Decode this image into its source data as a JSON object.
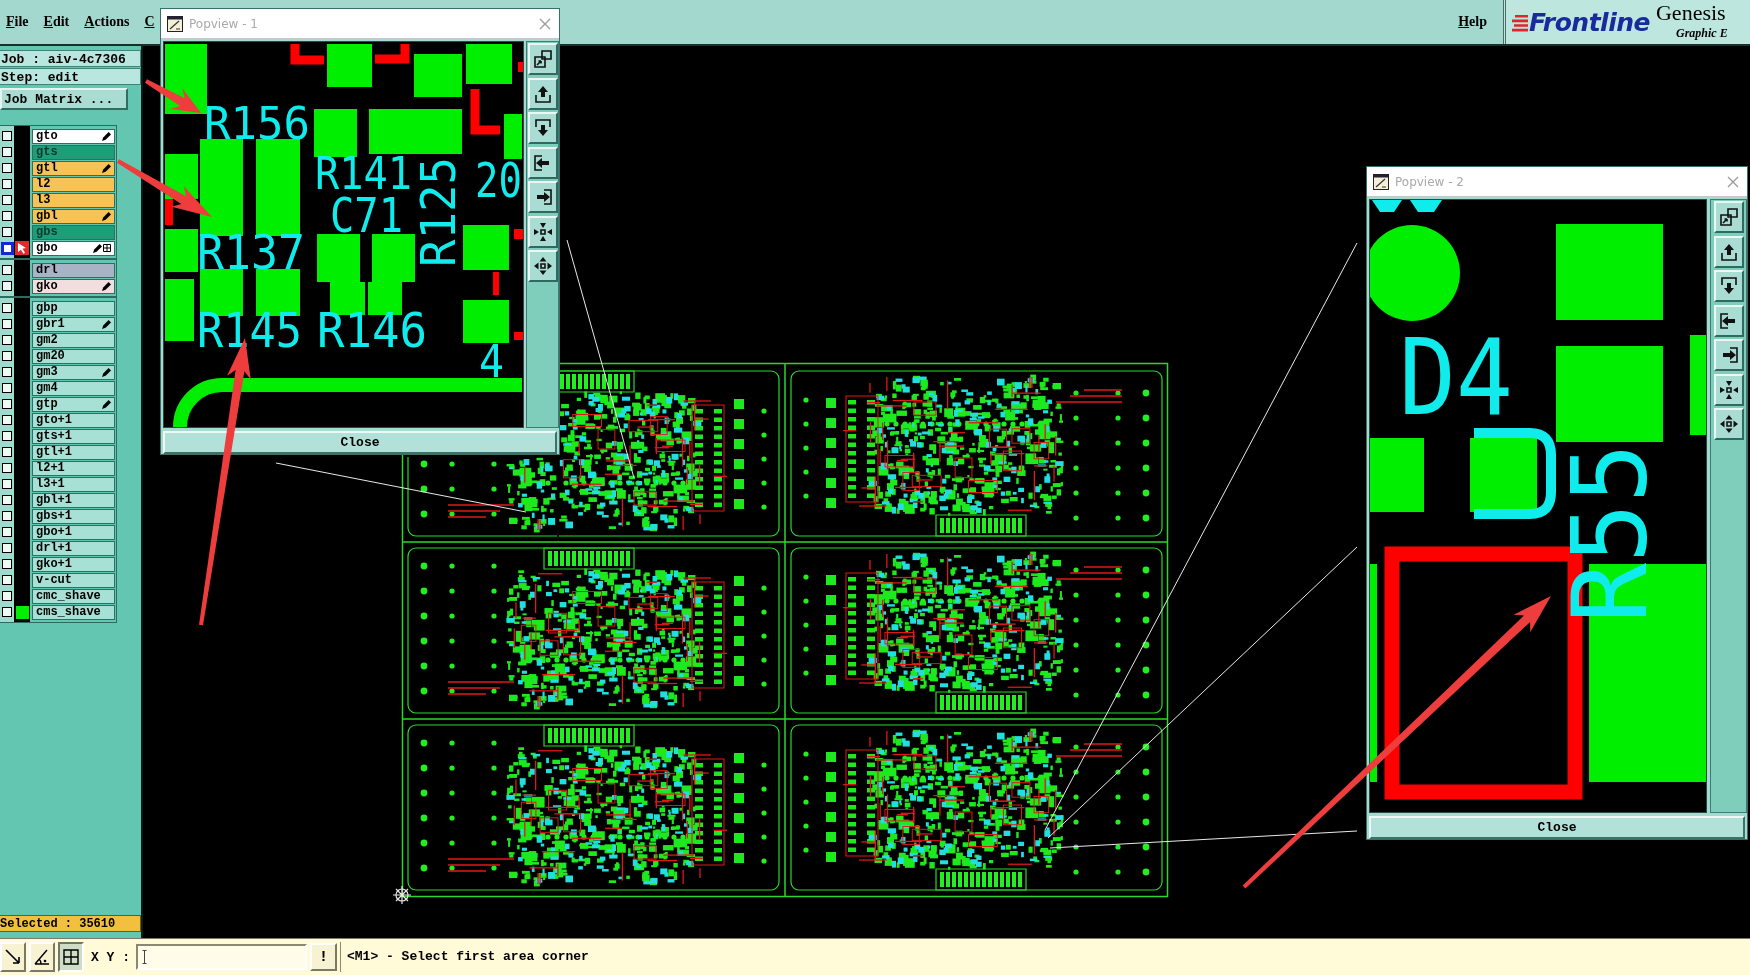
{
  "menu_bar": {
    "items": [
      {
        "label": "File"
      },
      {
        "label": "Edit"
      },
      {
        "label": "Actions"
      },
      {
        "label": "C"
      }
    ],
    "help": "Help"
  },
  "logo": {
    "brand": "Frontline",
    "product": "Genesis",
    "subtitle": "Graphic E"
  },
  "job_panel": {
    "job": "Job : aiv-4c7306",
    "step": "Step: edit",
    "matrix_button": "Job Matrix ..."
  },
  "layer_groups": [
    {
      "layers": [
        {
          "name": "gto",
          "color": "#ffffff",
          "checked": false,
          "work": false,
          "displayed": false,
          "pen_mark": true
        },
        {
          "name": "gts",
          "color": "#1d9e79",
          "checked": false,
          "work": false,
          "displayed": false,
          "pen_mark": false
        },
        {
          "name": "gtl",
          "color": "#f6c356",
          "checked": false,
          "work": false,
          "displayed": false,
          "pen_mark": true
        },
        {
          "name": "l2",
          "color": "#f6c356",
          "checked": false,
          "work": false,
          "displayed": false,
          "pen_mark": false
        },
        {
          "name": "l3",
          "color": "#f6c356",
          "checked": false,
          "work": false,
          "displayed": false,
          "pen_mark": false
        },
        {
          "name": "gbl",
          "color": "#f6c356",
          "checked": false,
          "work": false,
          "displayed": false,
          "pen_mark": true
        },
        {
          "name": "gbs",
          "color": "#1d9e79",
          "checked": false,
          "work": false,
          "displayed": false,
          "pen_mark": false
        },
        {
          "name": "gbo",
          "color": "#ffffff",
          "checked": false,
          "work": true,
          "displayed": false,
          "pen_mark": true
        }
      ]
    },
    {
      "layers": [
        {
          "name": "drl",
          "color": "#a9b3c6",
          "checked": false,
          "work": false,
          "displayed": false,
          "pen_mark": false
        },
        {
          "name": "gko",
          "color": "#f2dede",
          "checked": false,
          "work": false,
          "displayed": false,
          "pen_mark": true
        }
      ]
    },
    {
      "layers": [
        {
          "name": "gbp",
          "color": "#a7e0d4",
          "checked": false,
          "work": false,
          "displayed": false,
          "pen_mark": false
        },
        {
          "name": "gbr1",
          "color": "#a7e0d4",
          "checked": false,
          "work": false,
          "displayed": false,
          "pen_mark": true
        },
        {
          "name": "gm2",
          "color": "#a7e0d4",
          "checked": false,
          "work": false,
          "displayed": false,
          "pen_mark": false
        },
        {
          "name": "gm20",
          "color": "#a7e0d4",
          "checked": false,
          "work": false,
          "displayed": false,
          "pen_mark": false
        },
        {
          "name": "gm3",
          "color": "#a7e0d4",
          "checked": false,
          "work": false,
          "displayed": false,
          "pen_mark": true
        },
        {
          "name": "gm4",
          "color": "#a7e0d4",
          "checked": false,
          "work": false,
          "displayed": false,
          "pen_mark": false
        },
        {
          "name": "gtp",
          "color": "#a7e0d4",
          "checked": false,
          "work": false,
          "displayed": false,
          "pen_mark": true
        },
        {
          "name": "gto+1",
          "color": "#a7e0d4",
          "checked": false,
          "work": false,
          "displayed": false,
          "pen_mark": false
        },
        {
          "name": "gts+1",
          "color": "#a7e0d4",
          "checked": false,
          "work": false,
          "displayed": false,
          "pen_mark": false
        },
        {
          "name": "gtl+1",
          "color": "#a7e0d4",
          "checked": false,
          "work": false,
          "displayed": false,
          "pen_mark": false
        },
        {
          "name": "l2+1",
          "color": "#a7e0d4",
          "checked": false,
          "work": false,
          "displayed": false,
          "pen_mark": false
        },
        {
          "name": "l3+1",
          "color": "#a7e0d4",
          "checked": false,
          "work": false,
          "displayed": false,
          "pen_mark": false
        },
        {
          "name": "gbl+1",
          "color": "#a7e0d4",
          "checked": false,
          "work": false,
          "displayed": false,
          "pen_mark": false
        },
        {
          "name": "gbs+1",
          "color": "#a7e0d4",
          "checked": false,
          "work": false,
          "displayed": false,
          "pen_mark": false
        },
        {
          "name": "gbo+1",
          "color": "#a7e0d4",
          "checked": false,
          "work": false,
          "displayed": false,
          "pen_mark": false
        },
        {
          "name": "drl+1",
          "color": "#a7e0d4",
          "checked": false,
          "work": false,
          "displayed": false,
          "pen_mark": false
        },
        {
          "name": "gko+1",
          "color": "#a7e0d4",
          "checked": false,
          "work": false,
          "displayed": false,
          "pen_mark": false
        },
        {
          "name": "v-cut",
          "color": "#a7e0d4",
          "checked": false,
          "work": false,
          "displayed": false,
          "pen_mark": false
        },
        {
          "name": "cmc_shave",
          "color": "#a7e0d4",
          "checked": false,
          "work": false,
          "displayed": false,
          "pen_mark": false
        },
        {
          "name": "cms_shave",
          "color": "#a7e0d4",
          "checked": false,
          "work": false,
          "displayed": true,
          "pen_mark": false
        }
      ]
    }
  ],
  "selected_count": "Selected : 35610",
  "popviews": [
    {
      "title": "Popview - 1",
      "active": false,
      "labels": [
        {
          "text": "R156",
          "kind": "horizontal"
        },
        {
          "text": "R141",
          "kind": "horizontal"
        },
        {
          "text": "C71",
          "kind": "horizontal"
        },
        {
          "text": "R125",
          "kind": "vertical"
        },
        {
          "text": "20",
          "kind": "horizontal"
        },
        {
          "text": "R137",
          "kind": "horizontal"
        },
        {
          "text": "R145",
          "kind": "horizontal"
        },
        {
          "text": "R146",
          "kind": "horizontal"
        },
        {
          "text": "4",
          "kind": "horizontal"
        }
      ],
      "close_label": "Close"
    },
    {
      "title": "Popview - 2",
      "active": false,
      "labels": [
        {
          "text": "D4",
          "kind": "horizontal"
        },
        {
          "text": "R55",
          "kind": "vertical"
        }
      ],
      "close_label": "Close"
    }
  ],
  "status_bar": {
    "tools": [
      {
        "kind": "arrow",
        "selected": false
      },
      {
        "kind": "angle",
        "selected": false
      },
      {
        "kind": "grid",
        "selected": true
      }
    ],
    "xy_label": "X Y :",
    "alert": "!",
    "message": "<M1> - Select first area corner"
  }
}
